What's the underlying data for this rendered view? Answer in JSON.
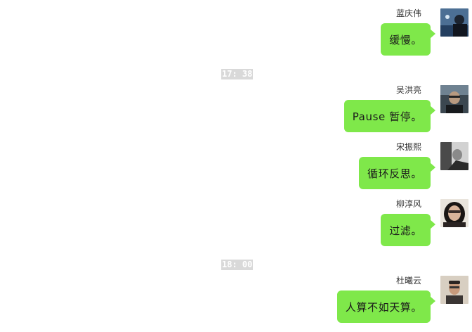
{
  "timestamps": [
    "17: 38",
    "18: 00"
  ],
  "messages": [
    {
      "sender": "蓝庆伟",
      "text": "缓慢。"
    },
    {
      "sender": "吴洪亮",
      "text": "Pause 暂停。"
    },
    {
      "sender": "宋振熙",
      "text": "循环反思。"
    },
    {
      "sender": "柳淳风",
      "text": "过滤。"
    },
    {
      "sender": "杜曦云",
      "text": "人算不如天算。"
    }
  ],
  "colors": {
    "bubble": "#7fe84a",
    "timestamp_bg": "#d9d9d9",
    "timestamp_text": "#ffffff"
  }
}
